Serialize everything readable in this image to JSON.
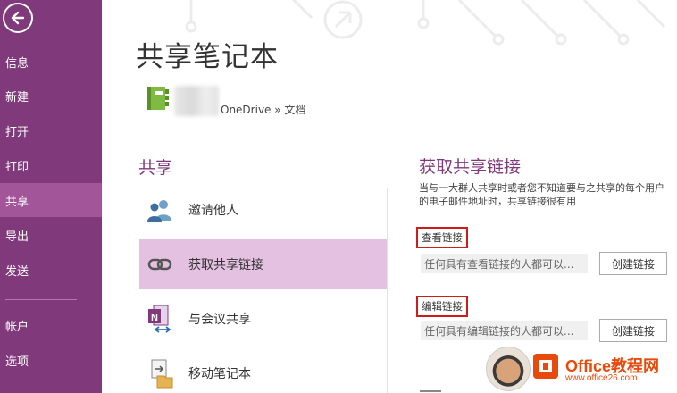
{
  "sidebar": {
    "items": [
      {
        "label": "信息"
      },
      {
        "label": "新建"
      },
      {
        "label": "打开"
      },
      {
        "label": "打印"
      },
      {
        "label": "共享"
      },
      {
        "label": "导出"
      },
      {
        "label": "发送"
      },
      {
        "label": "帐户"
      },
      {
        "label": "选项"
      }
    ],
    "active_index": 4
  },
  "main": {
    "title": "共享笔记本",
    "location": "OneDrive » 文档",
    "share_heading": "共享",
    "options": [
      {
        "label": "邀请他人",
        "icon": "people-icon"
      },
      {
        "label": "获取共享链接",
        "icon": "link-icon"
      },
      {
        "label": "与会议共享",
        "icon": "onenote-meeting-icon"
      },
      {
        "label": "移动笔记本",
        "icon": "move-notebook-icon"
      }
    ],
    "selected_index": 1
  },
  "panel": {
    "heading": "获取共享链接",
    "description": "当与一大群人共享时或者您不知道要与之共享的每个用户的电子邮件地址时，共享链接很有用",
    "view": {
      "label": "查看链接",
      "field_text": "任何具有查看链接的人都可以...",
      "button": "创建链接"
    },
    "edit": {
      "label": "编辑链接",
      "field_text": "任何具有编辑链接的人都可以...",
      "button": "创建链接"
    }
  },
  "watermark": {
    "brand": "Office教程网",
    "url": "www.office26.com"
  },
  "colors": {
    "accent": "#80397b",
    "active_nav": "#a35599",
    "selected_option": "#e4c1e0",
    "highlight_box": "#d11a1a"
  }
}
